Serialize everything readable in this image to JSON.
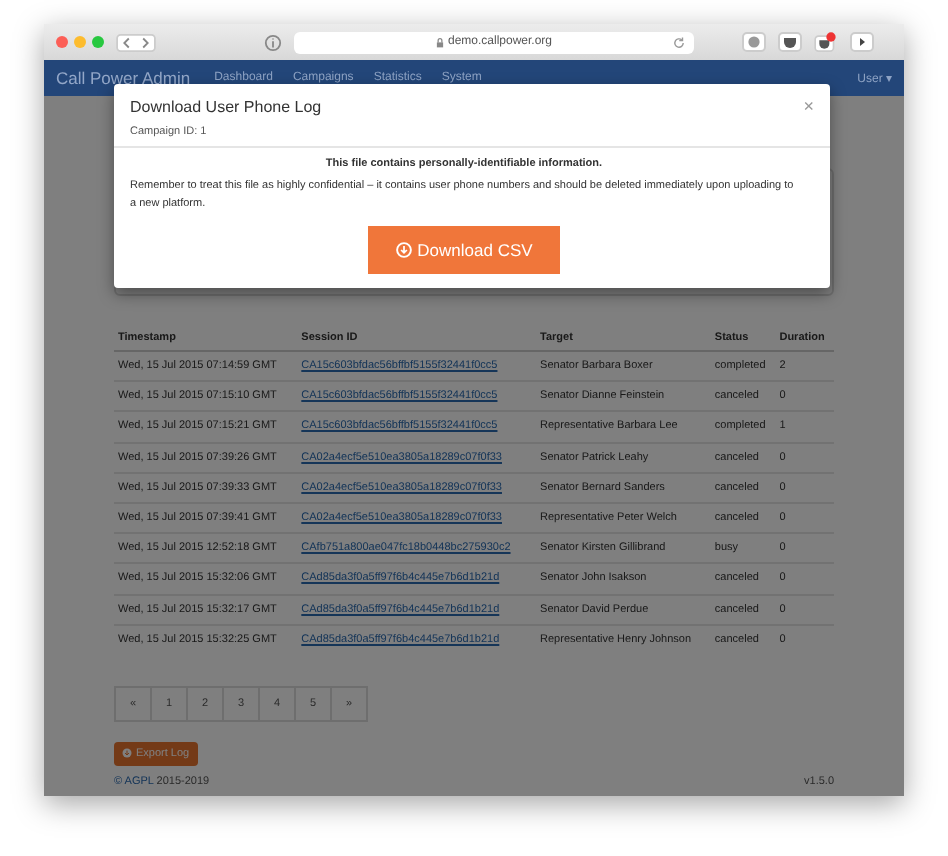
{
  "browser": {
    "address": "demo.callpower.org"
  },
  "navbar": {
    "brand": "Call Power Admin",
    "items": [
      {
        "label": "Dashboard"
      },
      {
        "label": "Campaigns"
      },
      {
        "label": "Statistics"
      },
      {
        "label": "System"
      }
    ],
    "user_menu": "User ▾"
  },
  "modal": {
    "title": "Download User Phone Log",
    "close": "×",
    "subtitle": "Campaign ID: 1",
    "warning": "This file contains personally-identifiable information.",
    "message": "Remember to treat this file as highly confidential – it contains user phone numbers and should be deleted immediately upon uploading to a new platform.",
    "button": "Download CSV"
  },
  "table": {
    "columns": [
      "Timestamp",
      "Session ID",
      "Target",
      "Status",
      "Duration"
    ],
    "rows": [
      [
        "Wed, 15 Jul 2015 07:14:59 GMT",
        "CA15c603bfdac56bffbf5155f32441f0cc5",
        "Senator Barbara Boxer",
        "completed",
        "2"
      ],
      [
        "Wed, 15 Jul 2015 07:15:10 GMT",
        "CA15c603bfdac56bffbf5155f32441f0cc5",
        "Senator Dianne Feinstein",
        "canceled",
        "0"
      ],
      [
        "Wed, 15 Jul 2015 07:15:21 GMT",
        "CA15c603bfdac56bffbf5155f32441f0cc5",
        "Representative Barbara Lee",
        "completed",
        "1"
      ],
      [
        "Wed, 15 Jul 2015 07:39:26 GMT",
        "CA02a4ecf5e510ea3805a18289c07f0f33",
        "Senator Patrick Leahy",
        "canceled",
        "0"
      ],
      [
        "Wed, 15 Jul 2015 07:39:33 GMT",
        "CA02a4ecf5e510ea3805a18289c07f0f33",
        "Senator Bernard Sanders",
        "canceled",
        "0"
      ],
      [
        "Wed, 15 Jul 2015 07:39:41 GMT",
        "CA02a4ecf5e510ea3805a18289c07f0f33",
        "Representative Peter Welch",
        "canceled",
        "0"
      ],
      [
        "Wed, 15 Jul 2015 12:52:18 GMT",
        "CAfb751a800ae047fc18b0448bc275930c2",
        "Senator Kirsten Gillibrand",
        "busy",
        "0"
      ],
      [
        "Wed, 15 Jul 2015 15:32:06 GMT",
        "CAd85da3f0a5ff97f6b4c445e7b6d1b21d",
        "Senator John Isakson",
        "canceled",
        "0"
      ],
      [
        "Wed, 15 Jul 2015 15:32:17 GMT",
        "CAd85da3f0a5ff97f6b4c445e7b6d1b21d",
        "Senator David Perdue",
        "canceled",
        "0"
      ],
      [
        "Wed, 15 Jul 2015 15:32:25 GMT",
        "CAd85da3f0a5ff97f6b4c445e7b6d1b21d",
        "Representative Henry Johnson",
        "canceled",
        "0"
      ]
    ]
  },
  "pagination": [
    {
      "label": "«"
    },
    {
      "label": "1"
    },
    {
      "label": "2"
    },
    {
      "label": "3"
    },
    {
      "label": "4"
    },
    {
      "label": "5"
    },
    {
      "label": "»"
    }
  ],
  "export_button": "Export Log",
  "footer": {
    "license": "© AGPL",
    "years": "2015-2019",
    "version": "v1.5.0"
  }
}
